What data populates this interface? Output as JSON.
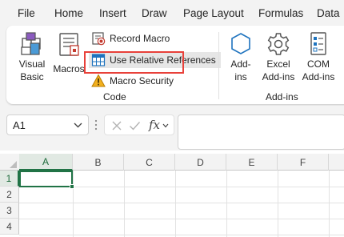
{
  "menu": [
    "File",
    "Home",
    "Insert",
    "Draw",
    "Page Layout",
    "Formulas",
    "Data"
  ],
  "ribbon": {
    "code_group": {
      "label": "Code",
      "visual_basic": [
        "Visual",
        "Basic"
      ],
      "macros": "Macros",
      "record_macro": "Record Macro",
      "use_relative_references": "Use Relative References",
      "macro_security": "Macro Security"
    },
    "addins_group": {
      "label": "Add-ins",
      "addins": [
        "Add-",
        "ins"
      ],
      "excel_addins": [
        "Excel",
        "Add-ins"
      ],
      "com_addins": [
        "COM",
        "Add-ins"
      ]
    }
  },
  "formula_bar": {
    "name_box": "A1",
    "fx": "fx",
    "formula": ""
  },
  "grid": {
    "columns": [
      "A",
      "B",
      "C",
      "D",
      "E",
      "F"
    ],
    "rows": [
      "1",
      "2",
      "3",
      "4"
    ],
    "active_cell": "A1"
  },
  "colors": {
    "highlight": "#e8413a",
    "excel_green": "#217346",
    "warning": "#d08a00",
    "icon_blue": "#1e73be"
  }
}
